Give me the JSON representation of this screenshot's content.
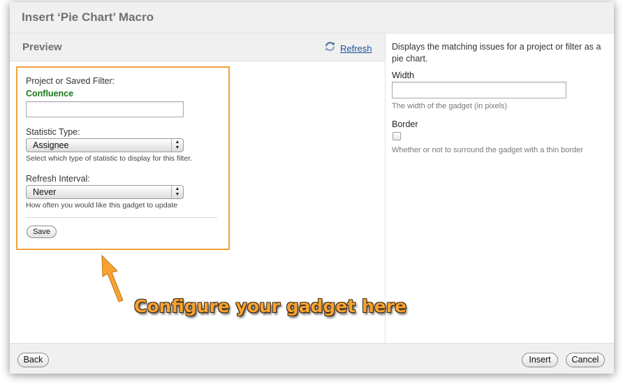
{
  "dialog": {
    "title": "Insert ‘Pie Chart’ Macro"
  },
  "preview": {
    "title": "Preview",
    "refresh_label": "Refresh",
    "refresh_icon": "refresh-icon"
  },
  "gadget": {
    "project_label": "Project or Saved Filter:",
    "project_value": "Confluence",
    "project_input_value": "",
    "statistic_label": "Statistic Type:",
    "statistic_selected": "Assignee",
    "statistic_help": "Select which type of statistic to display for this filter.",
    "refresh_interval_label": "Refresh Interval:",
    "refresh_interval_selected": "Never",
    "refresh_interval_help": "How often you would like this gadget to update",
    "save_label": "Save",
    "highlight_color": "#f0a23c"
  },
  "parameters": {
    "description": "Displays the matching issues for a project or filter as a pie chart.",
    "width_label": "Width",
    "width_value": "",
    "width_help": "The width of the gadget (in pixels)",
    "border_label": "Border",
    "border_checked": false,
    "border_help": "Whether or not to surround the gadget with a thin border"
  },
  "annotation": {
    "text": "Configure your gadget here",
    "color": "#f7a233"
  },
  "footer": {
    "back_label": "Back",
    "insert_label": "Insert",
    "cancel_label": "Cancel"
  }
}
